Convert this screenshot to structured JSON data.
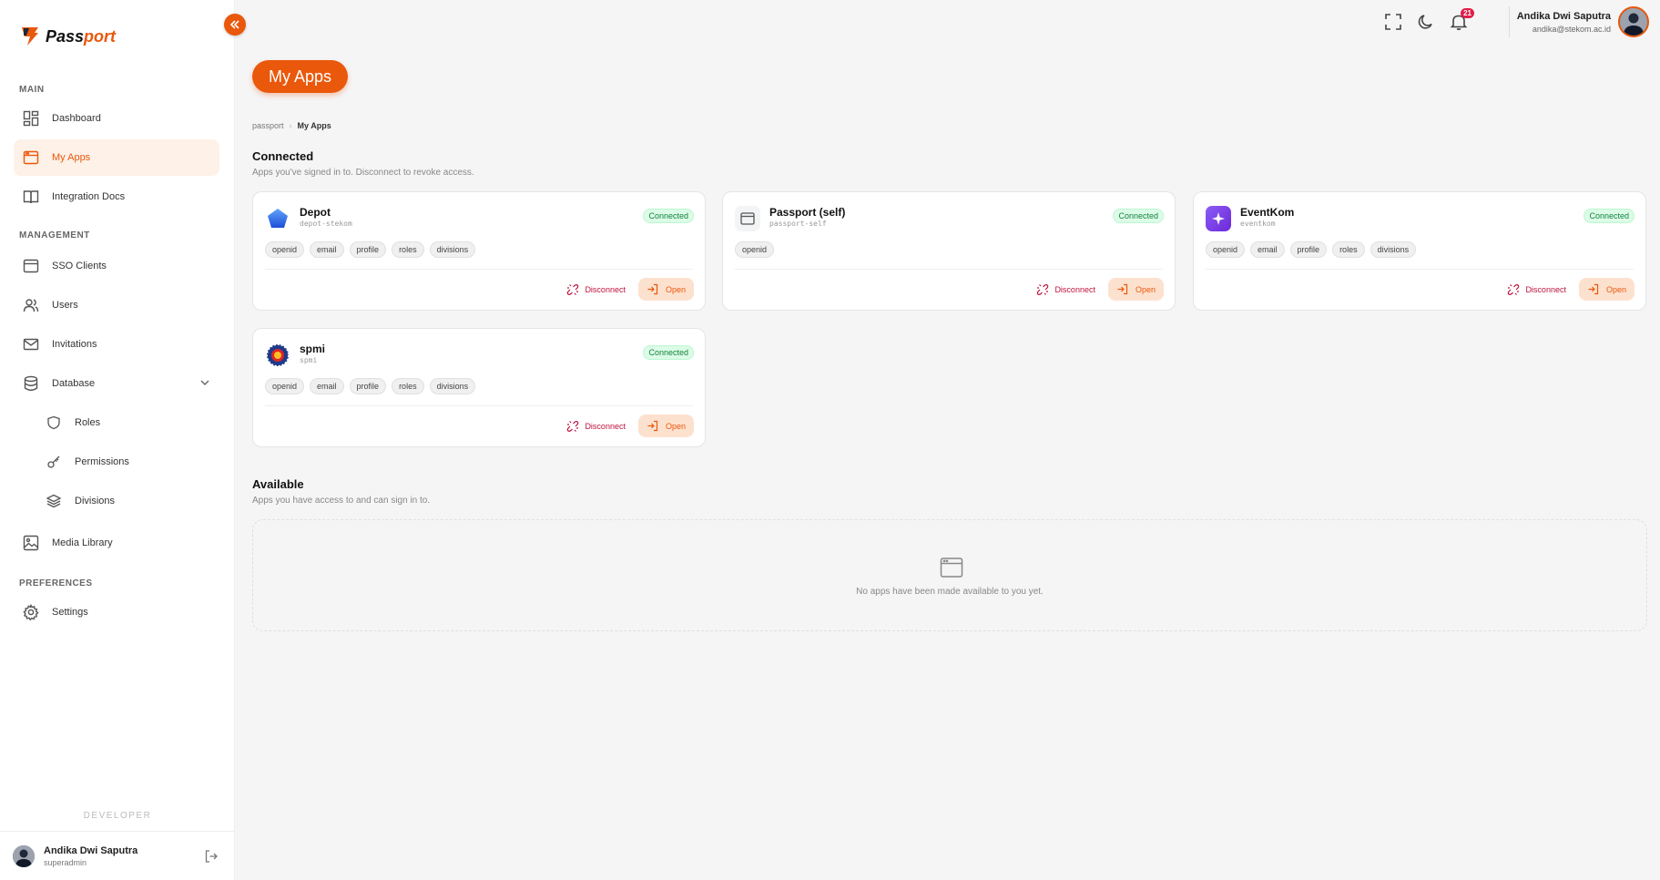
{
  "brand": {
    "name_prefix": "Pass",
    "name_suffix": "port"
  },
  "sidebar": {
    "sections": {
      "main": "MAIN",
      "management": "MANAGEMENT",
      "preferences": "PREFERENCES"
    },
    "items": {
      "dashboard": "Dashboard",
      "my_apps": "My Apps",
      "integration_docs": "Integration Docs",
      "sso_clients": "SSO Clients",
      "users": "Users",
      "invitations": "Invitations",
      "database": "Database",
      "roles": "Roles",
      "permissions": "Permissions",
      "divisions": "Divisions",
      "media_library": "Media Library",
      "settings": "Settings"
    },
    "developer_label": "DEVELOPER",
    "footer_user": {
      "name": "Andika Dwi Saputra",
      "role": "superadmin"
    }
  },
  "topbar": {
    "notification_count": "21",
    "user_name": "Andika Dwi Saputra",
    "user_email": "andika@stekom.ac.id"
  },
  "page": {
    "title": "My Apps",
    "breadcrumb": {
      "root": "passport",
      "sep": "›",
      "current": "My Apps"
    }
  },
  "connected": {
    "title": "Connected",
    "subtitle": "Apps you've signed in to. Disconnect to revoke access.",
    "status_label": "Connected",
    "disconnect_label": "Disconnect",
    "open_label": "Open",
    "apps": [
      {
        "name": "Depot",
        "slug": "depot-stekom",
        "icon": "pentagon-icon",
        "scopes": [
          "openid",
          "email",
          "profile",
          "roles",
          "divisions"
        ]
      },
      {
        "name": "Passport (self)",
        "slug": "passport-self",
        "icon": "window-icon",
        "scopes": [
          "openid"
        ]
      },
      {
        "name": "EventKom",
        "slug": "eventkom",
        "icon": "sparkle-icon",
        "scopes": [
          "openid",
          "email",
          "profile",
          "roles",
          "divisions"
        ]
      },
      {
        "name": "spmi",
        "slug": "spmi",
        "icon": "gear-emblem-icon",
        "scopes": [
          "openid",
          "email",
          "profile",
          "roles",
          "divisions"
        ]
      }
    ]
  },
  "available": {
    "title": "Available",
    "subtitle": "Apps you have access to and can sign in to.",
    "empty_message": "No apps have been made available to you yet."
  },
  "colors": {
    "accent": "#ea580c",
    "success": "#15803d",
    "danger": "#be123c"
  }
}
